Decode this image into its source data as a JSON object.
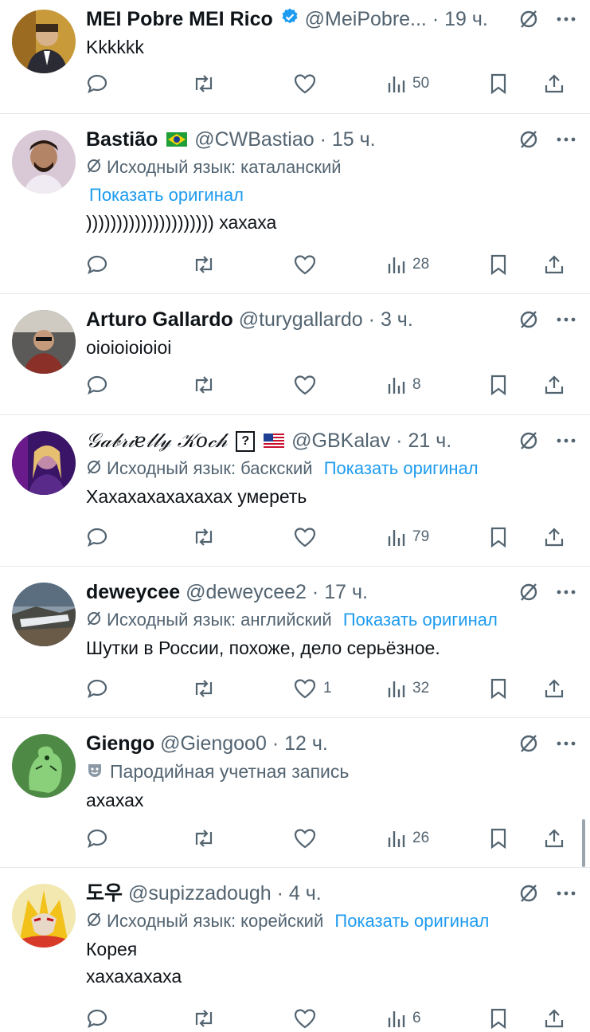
{
  "tweets": [
    {
      "name": "MEI Pobre MEI Rico",
      "verified": true,
      "handle": "@MeiPobre...",
      "time": "19 ч.",
      "meta_lang": "",
      "show_original": "",
      "text": "Kkkkkk",
      "likes": "",
      "views": "50"
    },
    {
      "name": "Bastião",
      "flag": "brazil-flag",
      "handle": "@CWBastiao",
      "time": "15 ч.",
      "meta_lang": "Исходный язык: каталанский",
      "show_original": "Показать оригинал",
      "text": "))))))))))))))))))))) хахаха",
      "likes": "",
      "views": "28"
    },
    {
      "name": "Arturo Gallardo",
      "handle": "@turygallardo",
      "time": "3 ч.",
      "meta_lang": "",
      "show_original": "",
      "text": "oioioioioioi",
      "likes": "",
      "views": "8"
    },
    {
      "name": "𝒢𝒶𝒷𝓇𝒾𝑒𝓁𝓁𝓎 𝒦𝑜𝒸𝒽",
      "badge": "?",
      "flag": "usa-flag",
      "handle": "@GBKalav",
      "time": "21 ч.",
      "meta_lang": "Исходный язык: баскский",
      "show_original": "Показать оригинал",
      "text": "Хахахахахахахах умереть",
      "likes": "",
      "views": "79"
    },
    {
      "name": "deweycee",
      "handle": "@deweycee2",
      "time": "17 ч.",
      "meta_lang": "Исходный язык: английский",
      "show_original": "Показать оригинал",
      "text": "Шутки в России, похоже, дело серьёзное.",
      "likes": "1",
      "views": "32"
    },
    {
      "name": "Giengo",
      "handle": "@Giengoo0",
      "time": "12 ч.",
      "parody_label": "Пародийная учетная запись",
      "text": "ахахах",
      "likes": "",
      "views": "26"
    },
    {
      "name": "도우",
      "handle": "@supizzadough",
      "time": "4 ч.",
      "meta_lang": "Исходный язык: корейский",
      "show_original": "Показать оригинал",
      "text_line1": "Корея",
      "text_line2": "хахахахаха",
      "likes": "",
      "views": "6"
    }
  ],
  "colors": {
    "link": "#1d9bf0",
    "muted": "#536471",
    "verified": "#1d9bf0"
  },
  "icons": [
    "reply-icon",
    "retweet-icon",
    "like-icon",
    "views-icon",
    "bookmark-icon",
    "share-icon",
    "grok-icon",
    "more-icon"
  ]
}
